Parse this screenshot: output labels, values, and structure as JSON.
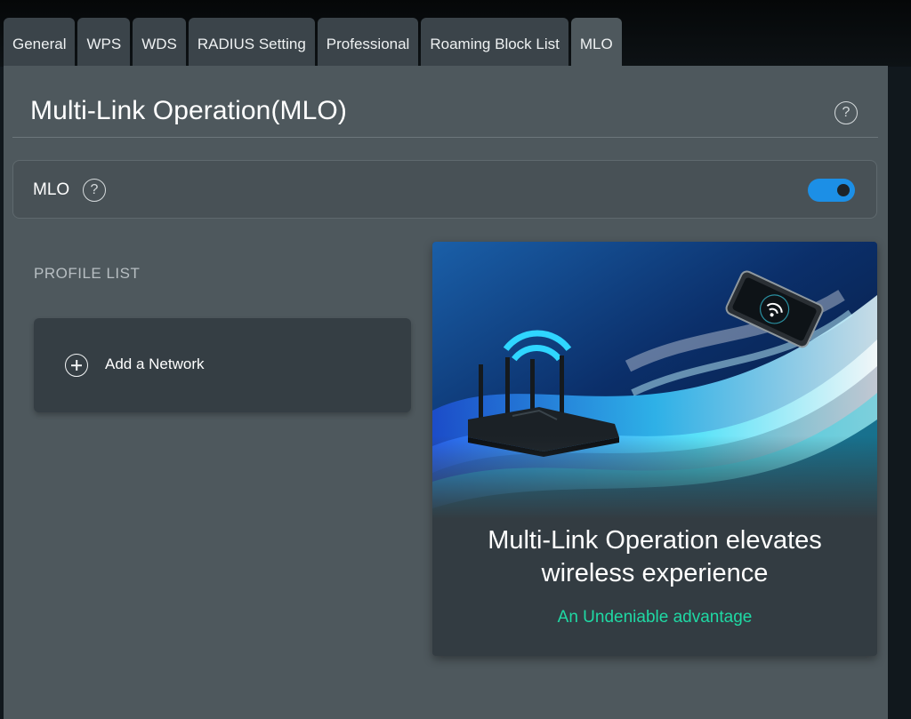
{
  "tabs": [
    {
      "label": "General",
      "active": false
    },
    {
      "label": "WPS",
      "active": false
    },
    {
      "label": "WDS",
      "active": false
    },
    {
      "label": "RADIUS Setting",
      "active": false
    },
    {
      "label": "Professional",
      "active": false
    },
    {
      "label": "Roaming Block List",
      "active": false
    },
    {
      "label": "MLO",
      "active": true
    }
  ],
  "page": {
    "title": "Multi-Link Operation(MLO)",
    "help_icon": "question-circle-icon"
  },
  "mlo": {
    "label": "MLO",
    "help_icon": "question-circle-icon",
    "enabled": true,
    "toggle_color": "#1c8fe6"
  },
  "profiles": {
    "header": "PROFILE LIST",
    "add_label": "Add a Network",
    "add_icon": "plus-circle-icon"
  },
  "promo": {
    "headline_line1": "Multi-Link Operation elevates",
    "headline_line2": "wireless experience",
    "subtitle": "An Undeniable advantage",
    "subtitle_color": "#1fd9a4",
    "illustration": "router-to-phone-wifi-illustration"
  }
}
